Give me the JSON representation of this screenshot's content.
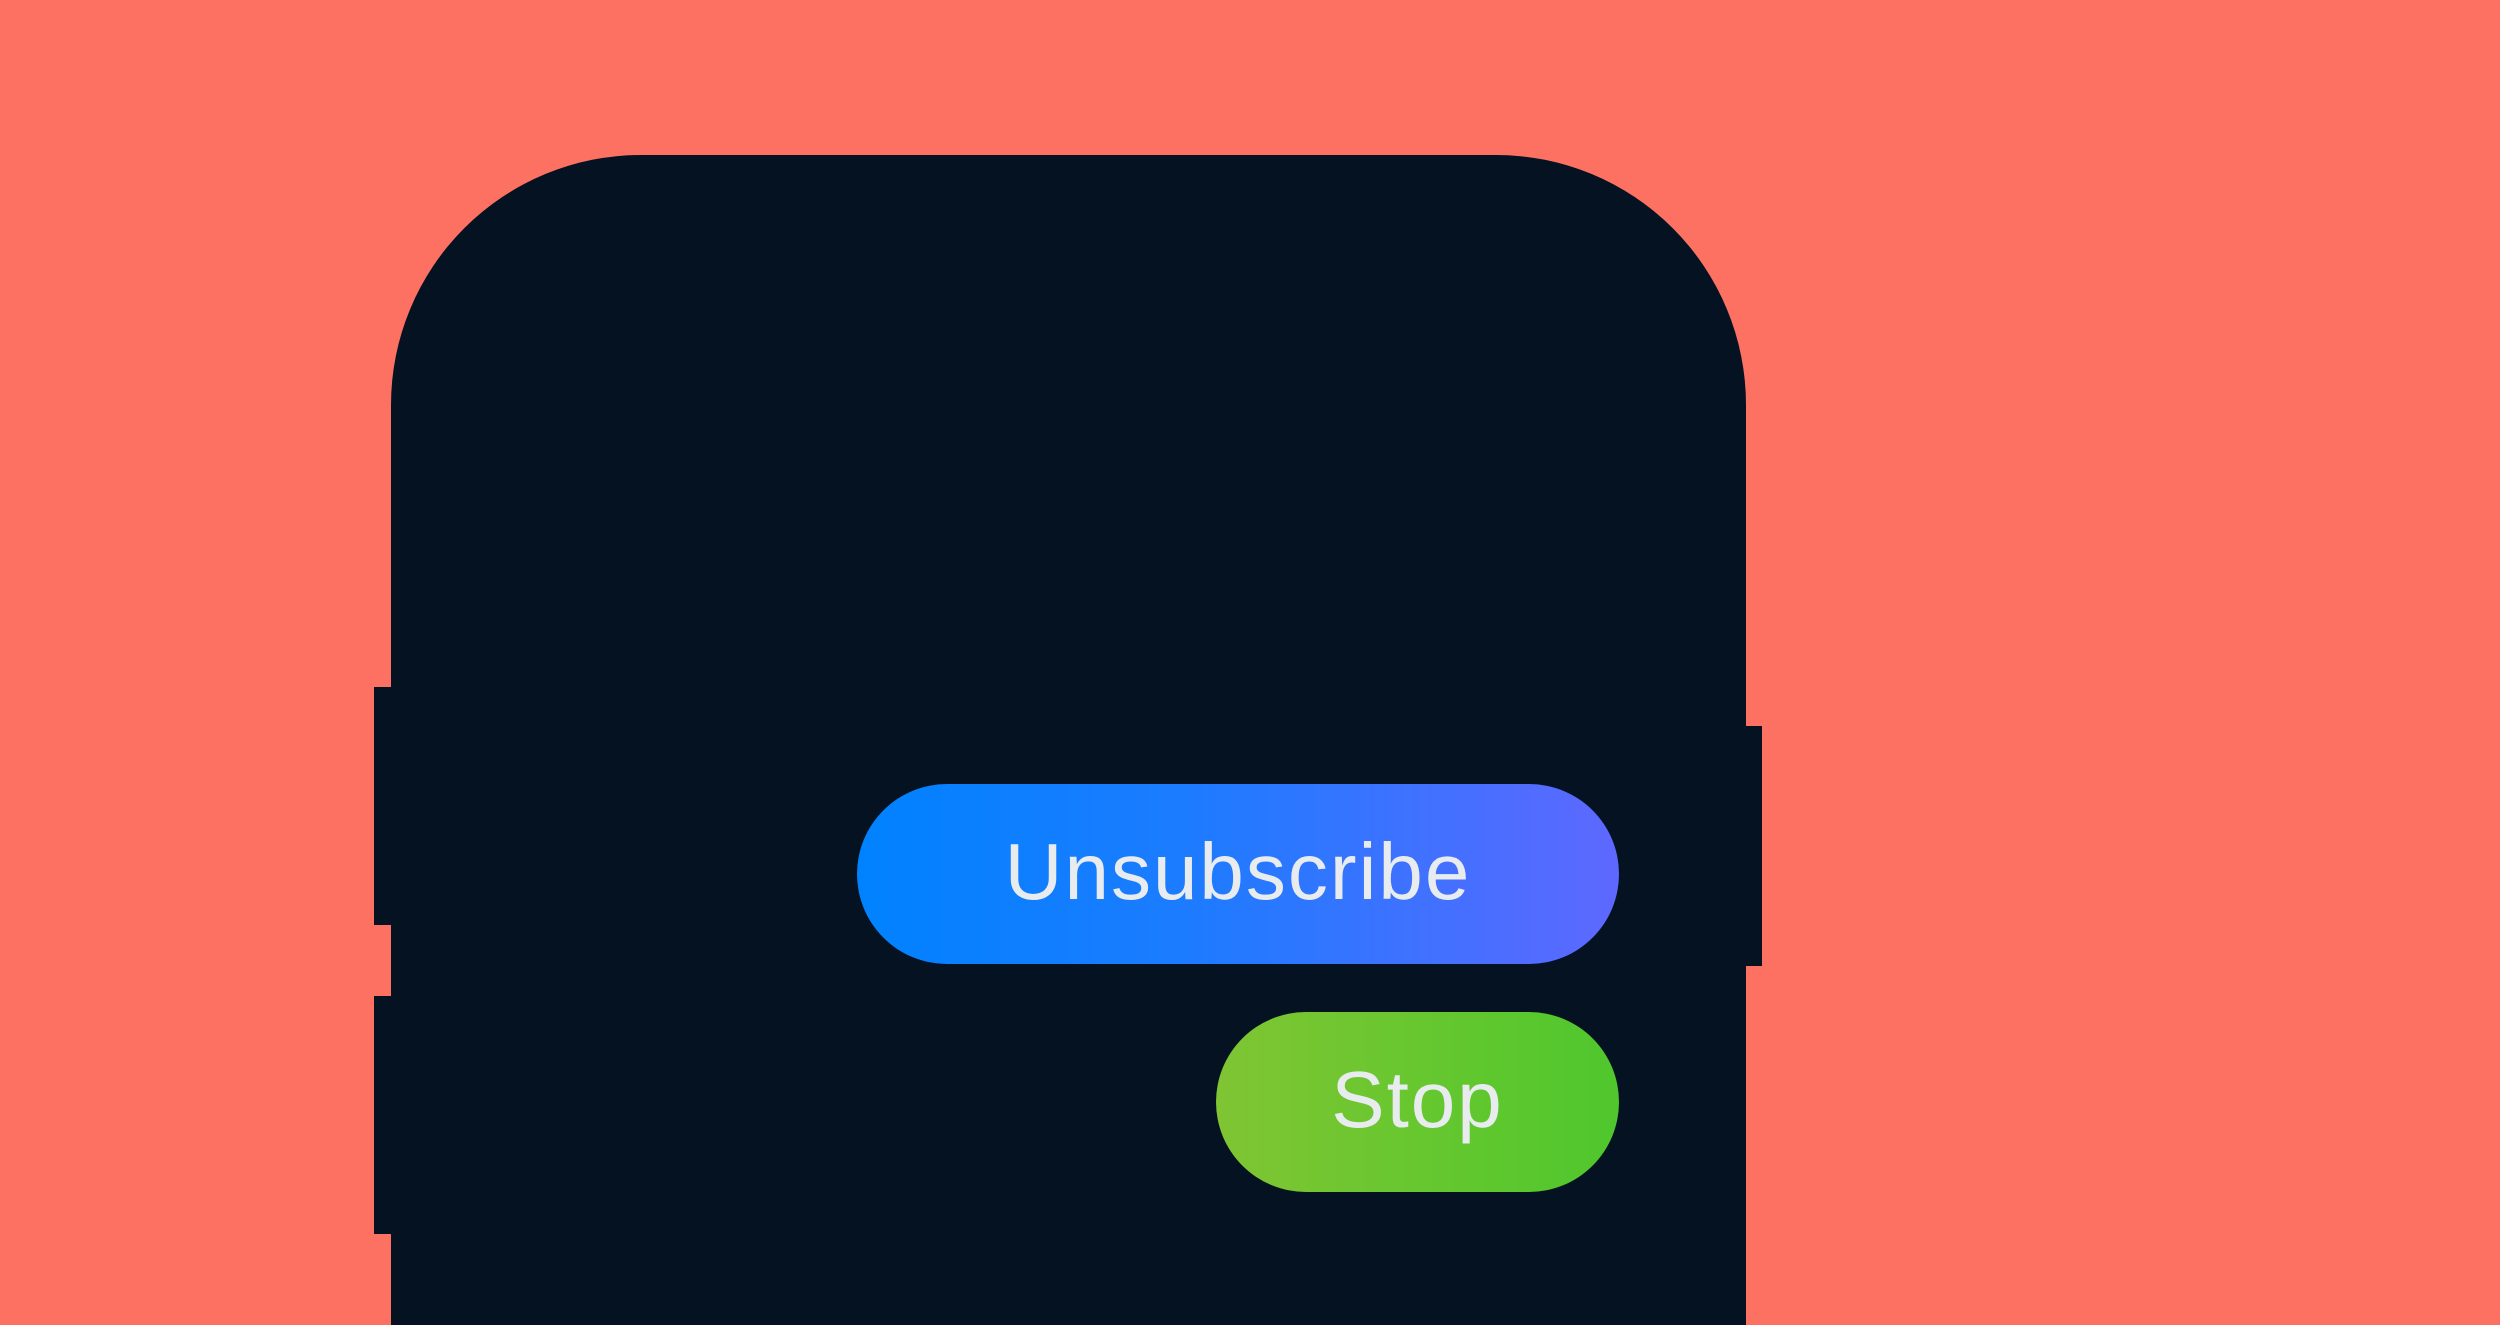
{
  "colors": {
    "background": "#FC7162",
    "phone_body": "#041221",
    "unsubscribe_gradient": [
      "#0082FF",
      "#5E68FF"
    ],
    "stop_gradient": [
      "#80C533",
      "#4FC72D"
    ],
    "button_text": "#E8ECEF"
  },
  "buttons": {
    "unsubscribe_label": "Unsubscribe",
    "stop_label": "Stop"
  }
}
